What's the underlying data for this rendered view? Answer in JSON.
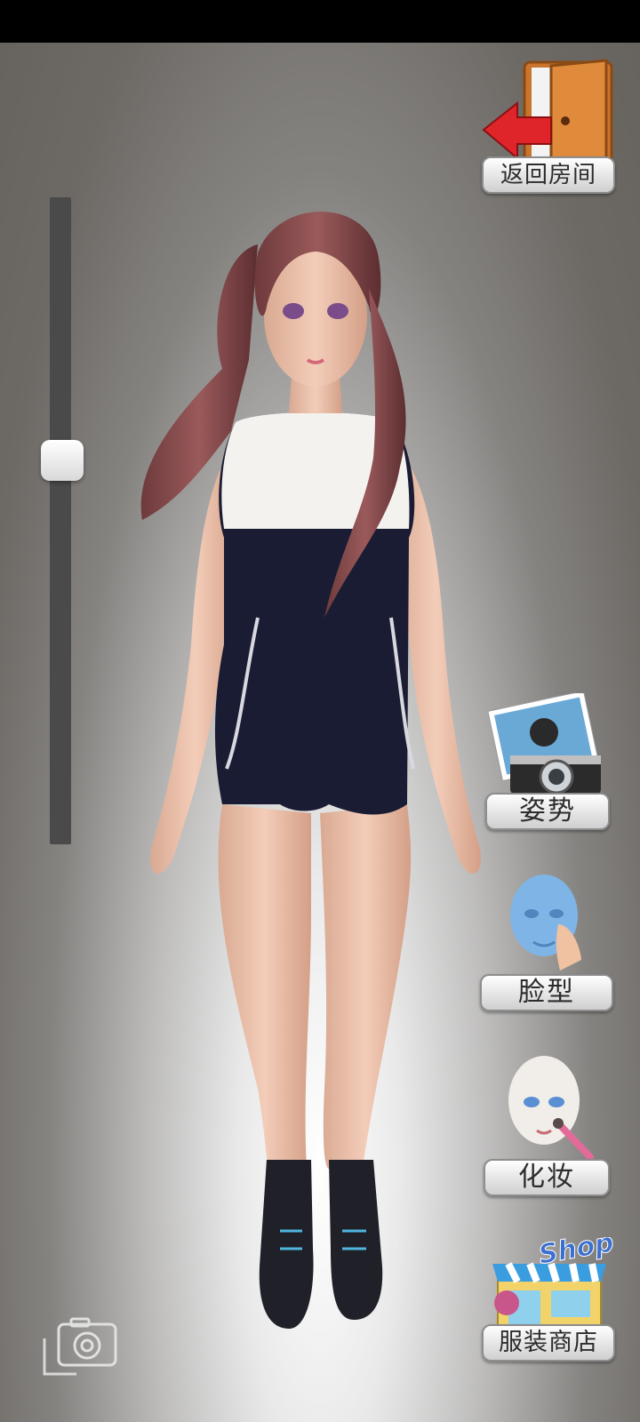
{
  "buttons": {
    "return_room": "返回房间",
    "pose": "姿势",
    "face_shape": "脸型",
    "makeup": "化妆",
    "clothing_shop": "服装商店"
  },
  "shop_sign": "Shop",
  "zoom_slider": {
    "value": 0.4
  },
  "icons": {
    "exit": "door-exit-icon",
    "pose": "photo-camera-icon",
    "face_shape": "face-model-icon",
    "makeup": "makeup-brush-icon",
    "shop": "shop-storefront-icon",
    "screenshot": "camera-icon"
  },
  "colors": {
    "label_text": "#2c2c2c",
    "swimsuit": "#1a1c33",
    "background": "#6d6965"
  }
}
